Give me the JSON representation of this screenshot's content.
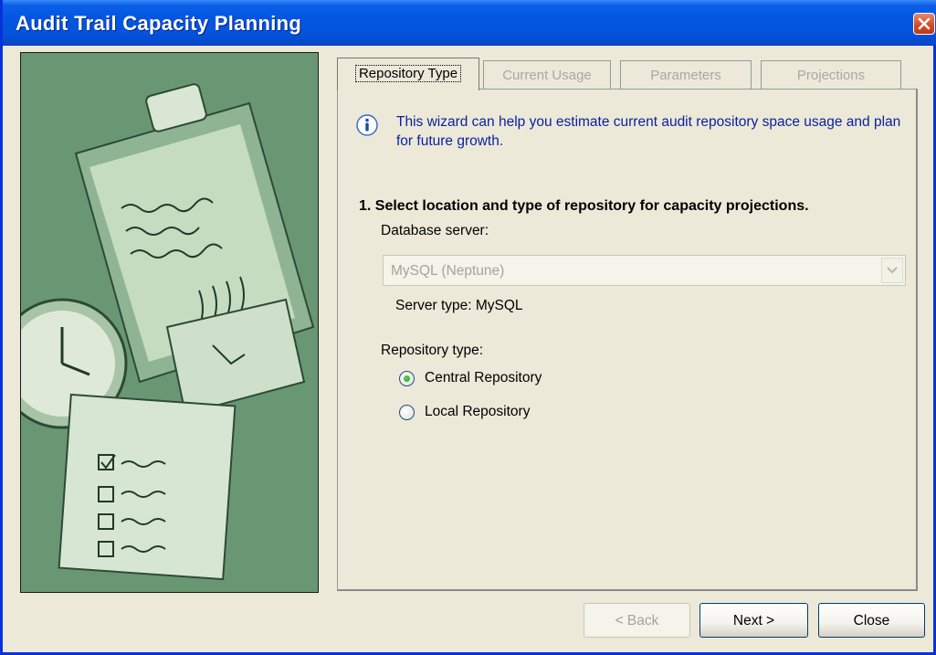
{
  "window": {
    "title": "Audit Trail Capacity Planning"
  },
  "tabs": [
    {
      "label": "Repository Type",
      "active": true
    },
    {
      "label": "Current Usage",
      "active": false
    },
    {
      "label": "Parameters",
      "active": false
    },
    {
      "label": "Projections",
      "active": false
    }
  ],
  "info": {
    "text": "This wizard can help you estimate current audit repository space usage and plan for future growth."
  },
  "step": {
    "heading": "1. Select location and type of repository for capacity projections."
  },
  "database": {
    "label": "Database server:",
    "selected": "MySQL (Neptune)",
    "server_type_label": "Server type:",
    "server_type_value": "MySQL"
  },
  "repository": {
    "label": "Repository type:",
    "options": [
      {
        "label": "Central Repository",
        "checked": true
      },
      {
        "label": "Local Repository",
        "checked": false
      }
    ]
  },
  "buttons": {
    "back": "< Back",
    "next": "Next >",
    "close": "Close"
  },
  "colors": {
    "titlebar": "#0456e0",
    "accent_text": "#0a1fa0",
    "dialog_bg": "#ece9d8"
  }
}
